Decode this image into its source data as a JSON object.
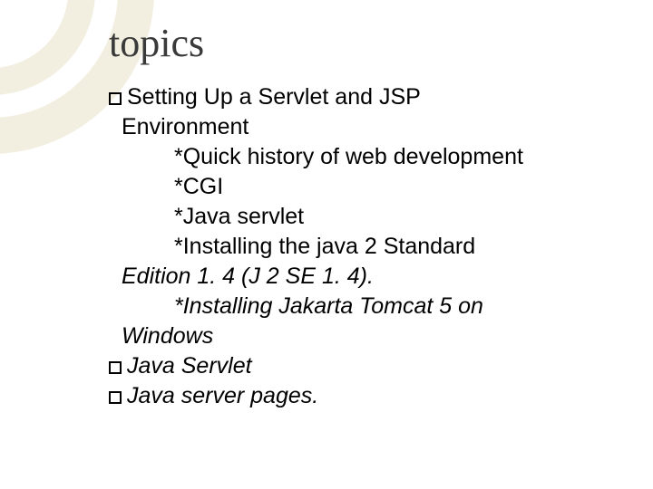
{
  "title": "topics",
  "topic1": {
    "heading_part1": "Setting Up a Servlet and JSP",
    "heading_part2": "Environment",
    "sub1": "*Quick history of web development",
    "sub2": "*CGI",
    "sub3": "*Java servlet",
    "sub4a": "*Installing the java 2 Standard",
    "sub4b": "Edition 1. 4 (J 2 SE 1. 4).",
    "sub5a": "*Installing Jakarta Tomcat 5 on",
    "sub5b": "Windows"
  },
  "topic2": "Java Servlet",
  "topic3": "Java server pages."
}
